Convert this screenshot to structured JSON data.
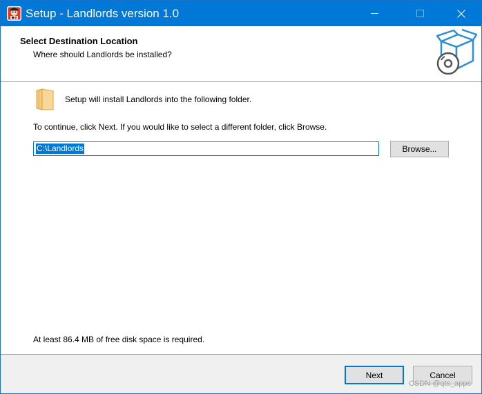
{
  "window": {
    "title": "Setup - Landlords version 1.0",
    "controls": {
      "minimize": "minimize-icon",
      "maximize": "maximize-icon",
      "close": "close-icon"
    }
  },
  "header": {
    "title": "Select Destination Location",
    "subtitle": "Where should Landlords be installed?"
  },
  "content": {
    "select_dir_label": "Setup will install Landlords into the following folder.",
    "instruction": "To continue, click Next. If you would like to select a different folder, click Browse.",
    "dir_value": "C:\\Landlords",
    "browse_label": "Browse...",
    "disk_space": "At least 86.4 MB of free disk space is required."
  },
  "footer": {
    "next_label": "Next",
    "cancel_label": "Cancel"
  },
  "watermark": "CSDN @qts_apps",
  "colors": {
    "titlebar": "#0078d7",
    "selection": "#0078d7",
    "dialog_bg": "#f0f0f0",
    "button_bg": "#e1e1e1",
    "folder": "#f5c97a"
  }
}
